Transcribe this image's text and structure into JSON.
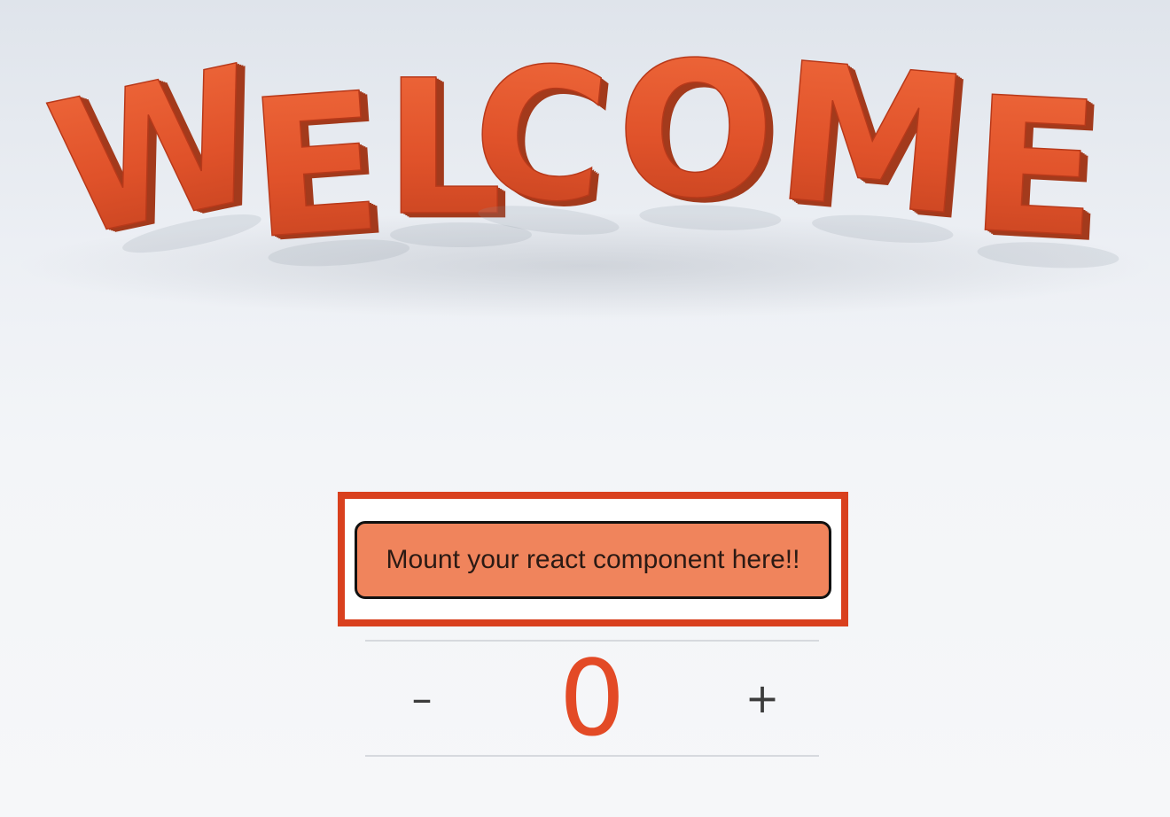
{
  "hero": {
    "logo_text": "WELCOME",
    "letters": [
      "W",
      "E",
      "L",
      "C",
      "O",
      "M",
      "E"
    ],
    "letter_color": "#e4572e",
    "shadow_color": "#a33a1c"
  },
  "mount": {
    "label": "Mount your react component here!!",
    "frame_color": "#d9401e",
    "pill_color": "#f0845c"
  },
  "counter": {
    "decrement_label": "–",
    "value": "0",
    "increment_label": "+",
    "value_color": "#e34a26"
  }
}
